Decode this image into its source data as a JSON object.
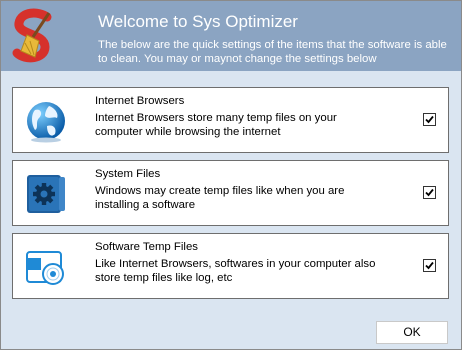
{
  "window": {
    "title": "Welcome to Sys Optimizer",
    "description": "The below are the quick settings of the items that the software is able to clean. You may or maynot change the settings below",
    "logo_icon": "broom-s-logo-icon"
  },
  "items": [
    {
      "icon": "globe-icon",
      "title": "Internet Browsers",
      "description": "Internet Browsers store many temp files on your computer while browsing the internet",
      "checked": true
    },
    {
      "icon": "system-gear-icon",
      "title": "System Files",
      "description": "Windows may create temp files like when you are installing a software",
      "checked": true
    },
    {
      "icon": "disc-software-icon",
      "title": "Software Temp Files",
      "description": "Like Internet Browsers, softwares in your computer also store temp files like log, etc",
      "checked": true
    }
  ],
  "footer": {
    "ok_label": "OK"
  },
  "colors": {
    "header": "#8ba4c2",
    "body": "#dae5f1",
    "card": "#ffffff"
  }
}
